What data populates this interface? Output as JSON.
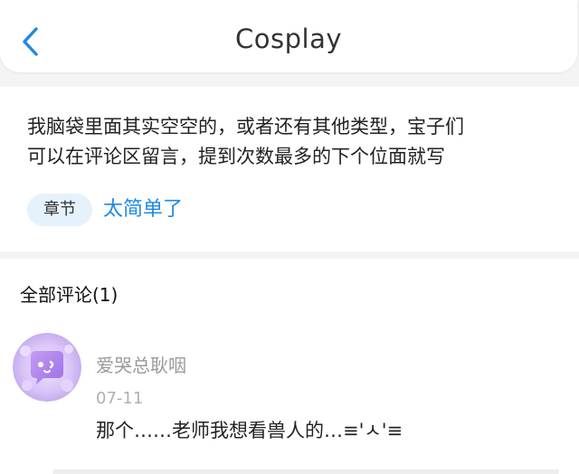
{
  "header": {
    "title": "Cosplay",
    "back_icon": "chevron-left-icon",
    "accent_color": "#1e88e5"
  },
  "post": {
    "text_line1": "我脑袋里面其实空空的，或者还有其他类型，宝子们",
    "text_line2": "可以在评论区留言，提到次数最多的下个位面就写",
    "chapter_tag": "章节",
    "chapter_link": "太简单了"
  },
  "comments": {
    "header": "全部评论(1)",
    "items": [
      {
        "username": "爱哭总耿咽",
        "date": "07-11",
        "text": "那个……老师我想看兽人的…≡'ㅅ'≡",
        "avatar_icon": "chat-bubble-avatar-icon"
      }
    ]
  }
}
